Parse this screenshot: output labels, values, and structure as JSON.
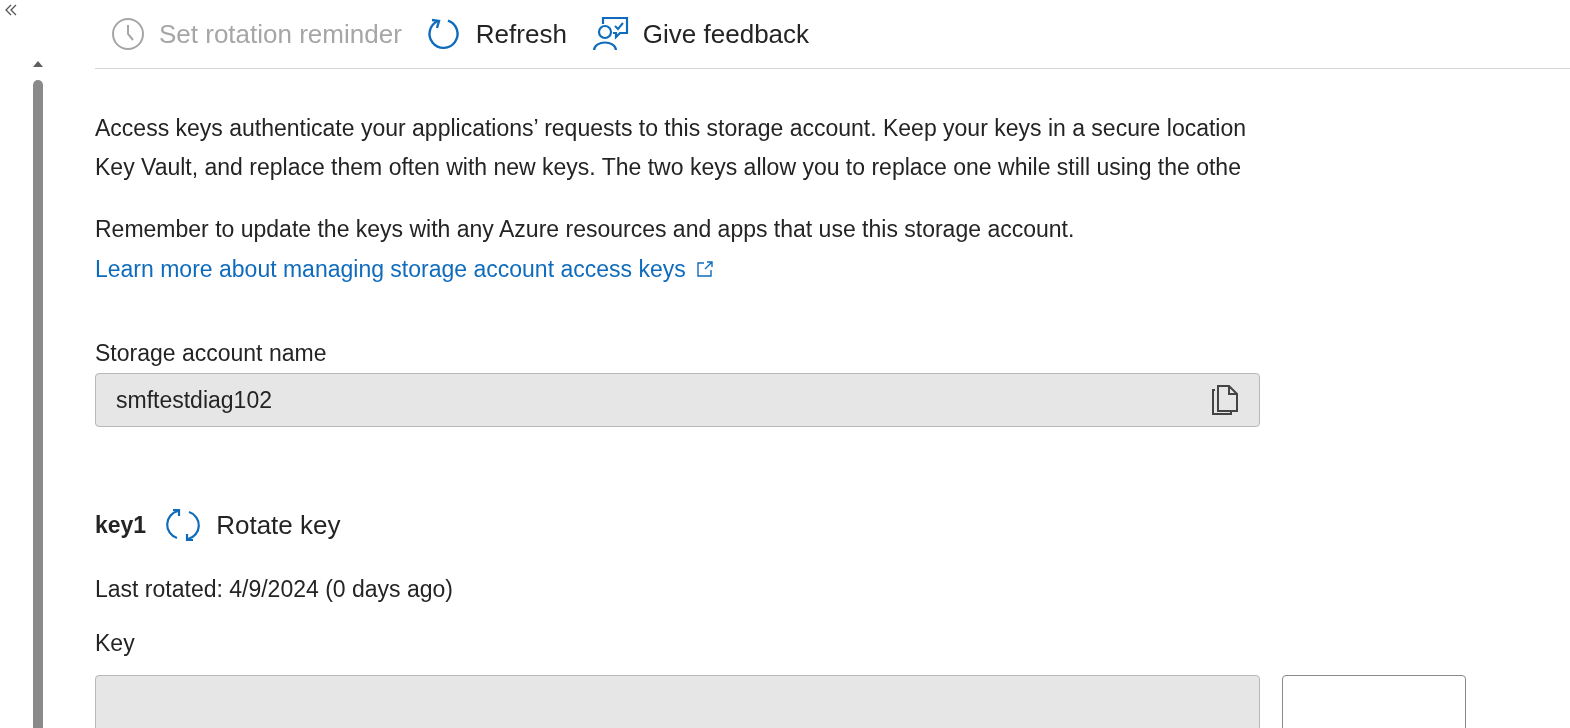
{
  "toolbar": [
    {
      "kind": "clock",
      "label": "Set rotation reminder",
      "disabled": true
    },
    {
      "kind": "refresh",
      "label": "Refresh",
      "disabled": false
    },
    {
      "kind": "feedback",
      "label": "Give feedback",
      "disabled": false
    }
  ],
  "description": "Access keys authenticate your applications’ requests to this storage account. Keep your keys in a secure location\nKey Vault, and replace them often with new keys. The two keys allow you to replace one while still using the othe",
  "reminder": "Remember to update the keys with any Azure resources and apps that use this storage account.",
  "learn_more_link": "Learn more about managing storage account access keys",
  "storage_account": {
    "label": "Storage account name",
    "value": "smftestdiag102"
  },
  "key1": {
    "title": "key1",
    "rotate_label": "Rotate key",
    "last_rotated": "Last rotated: 4/9/2024 (0 days ago)",
    "key_label": "Key"
  }
}
